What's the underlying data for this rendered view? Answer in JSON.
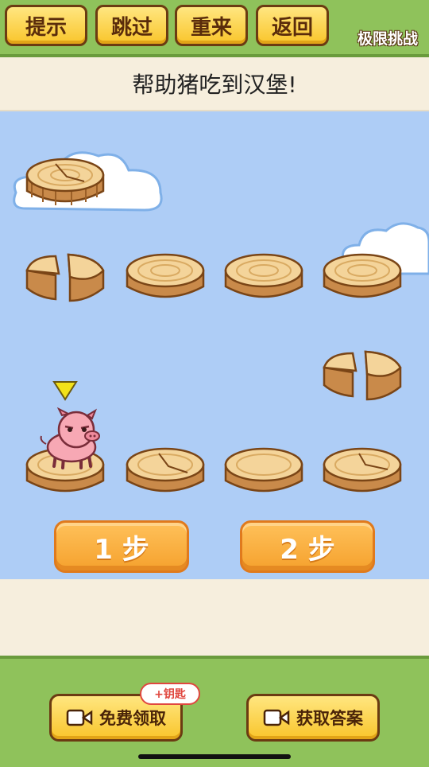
{
  "toolbar": {
    "hint_label": "提示",
    "skip_label": "跳过",
    "restart_label": "重来",
    "back_label": "返回",
    "level_tag": "极限挑战"
  },
  "puzzle": {
    "prompt": "帮助猪吃到汉堡!"
  },
  "step_buttons": {
    "one_step": "1 步",
    "two_step": "2 步"
  },
  "bottom": {
    "free_claim_label": "免费领取",
    "free_claim_badge": "+钥匙",
    "get_answer_label": "获取答案"
  },
  "icons": {
    "marker": "triangle-marker-icon",
    "video": "video-camera-icon"
  },
  "colors": {
    "accent_yellow": "#f9c52b",
    "sky": "#aecdf6",
    "grass": "#8fc25b",
    "step_orange": "#f5a12d"
  }
}
